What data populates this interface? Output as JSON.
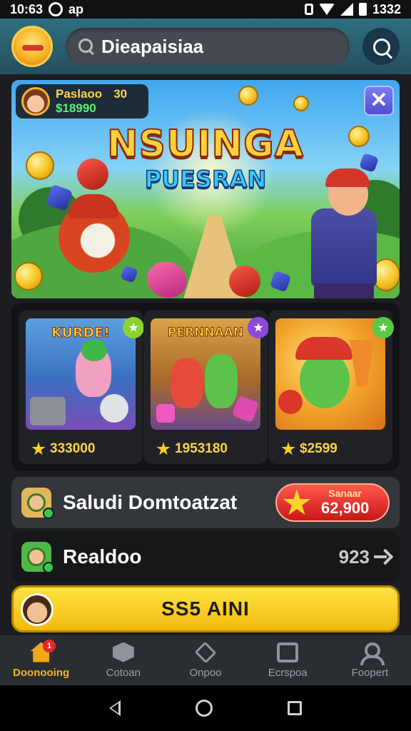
{
  "status_bar": {
    "time_left": "10:63",
    "app_badge": "ap",
    "time_right": "1332"
  },
  "header": {
    "search_placeholder": "Dieapaisiaa",
    "search_value": "Dieapaisiaa"
  },
  "banner": {
    "title_line1": "NSUINGA",
    "title_line2": "PUESRAN",
    "player_name": "Paslaoo",
    "player_level": "30",
    "player_balance": "$18990",
    "close_label": "✕"
  },
  "games": [
    {
      "title": "KURDE!",
      "price": "333000",
      "badge_color": "#8bd22e",
      "thumb_bg": "#5aa0e0"
    },
    {
      "title": "PERNNAAN",
      "price": "1953180",
      "badge_color": "#8a4ad8",
      "thumb_bg": "#c8a04a"
    },
    {
      "title": "",
      "price": "$2599",
      "badge_color": "#5bc742",
      "thumb_bg": "#f2a42a"
    }
  ],
  "reward_row": {
    "label": "Saludi Domtoatzat",
    "pill_small": "Sanaar",
    "pill_big": "62,900"
  },
  "recent_row": {
    "label": "Realdoo",
    "count": "923"
  },
  "cta": {
    "label": "SS5 AINI"
  },
  "bottom_nav": [
    {
      "label": "Doonooing",
      "icon": "home-icon",
      "active": true,
      "badge": "1"
    },
    {
      "label": "Cotoan",
      "icon": "box-icon",
      "active": false
    },
    {
      "label": "Onpoo",
      "icon": "stack-icon",
      "active": false
    },
    {
      "label": "Ecrspoa",
      "icon": "calendar-icon",
      "active": false
    },
    {
      "label": "Foopert",
      "icon": "user-icon",
      "active": false
    }
  ],
  "colors": {
    "accent": "#f5b21f",
    "header": "#2d6f80",
    "cta": "#ffd21f",
    "reward": "#e02a2a"
  }
}
